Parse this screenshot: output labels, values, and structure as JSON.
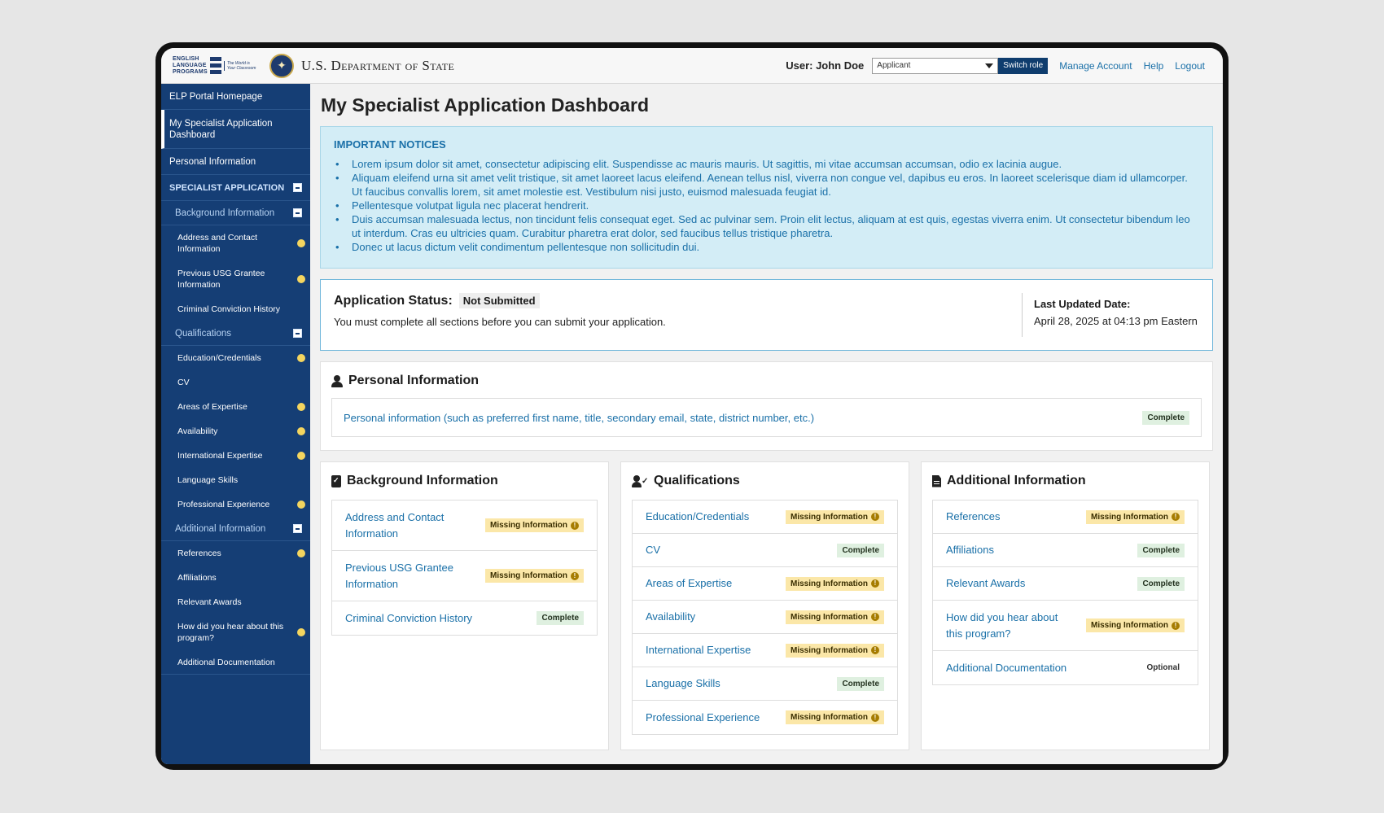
{
  "header": {
    "elp_logo_text": "ENGLISH LANGUAGE PROGRAMS",
    "elp_tagline": "The World is Your Classroom",
    "agency": "U.S. Department of State",
    "user_label": "User: John Doe",
    "role_value": "Applicant",
    "switch_role": "Switch role",
    "links": [
      "Manage Account",
      "Help",
      "Logout"
    ]
  },
  "sidebar": {
    "top": [
      {
        "label": "ELP Portal Homepage"
      },
      {
        "label": "My Specialist Application Dashboard"
      },
      {
        "label": "Personal Information"
      }
    ],
    "section": "SPECIALIST APPLICATION",
    "groups": [
      {
        "label": "Background Information",
        "items": [
          {
            "label": "Address and Contact Information",
            "flag": true
          },
          {
            "label": "Previous USG Grantee Information",
            "flag": true
          },
          {
            "label": "Criminal Conviction History",
            "flag": false
          }
        ]
      },
      {
        "label": "Qualifications",
        "items": [
          {
            "label": "Education/Credentials",
            "flag": true
          },
          {
            "label": "CV",
            "flag": false
          },
          {
            "label": "Areas of Expertise",
            "flag": true
          },
          {
            "label": "Availability",
            "flag": true
          },
          {
            "label": "International Expertise",
            "flag": true
          },
          {
            "label": "Language Skills",
            "flag": false
          },
          {
            "label": "Professional Experience",
            "flag": true
          }
        ]
      },
      {
        "label": "Additional Information",
        "items": [
          {
            "label": "References",
            "flag": true
          },
          {
            "label": "Affiliations",
            "flag": false
          },
          {
            "label": "Relevant Awards",
            "flag": false
          },
          {
            "label": "How did you hear about this program?",
            "flag": true
          },
          {
            "label": "Additional Documentation",
            "flag": false
          }
        ]
      }
    ]
  },
  "main": {
    "title": "My Specialist Application Dashboard",
    "notices": {
      "title": "IMPORTANT NOTICES",
      "items": [
        "Lorem ipsum dolor sit amet, consectetur adipiscing elit. Suspendisse ac mauris mauris. Ut sagittis, mi vitae accumsan accumsan, odio ex lacinia augue.",
        "Aliquam eleifend urna sit amet velit tristique, sit amet laoreet lacus eleifend. Aenean tellus nisl, viverra non congue vel, dapibus eu eros. In laoreet scelerisque diam id ullamcorper. Ut faucibus convallis lorem, sit amet molestie est. Vestibulum nisi justo, euismod malesuada feugiat id.",
        "Pellentesque volutpat ligula nec placerat hendrerit.",
        "Duis accumsan malesuada lectus, non tincidunt felis consequat eget. Sed ac pulvinar sem. Proin elit lectus, aliquam at est quis, egestas viverra enim. Ut consectetur bibendum leo ut interdum. Cras eu ultricies quam. Curabitur pharetra erat dolor, sed faucibus tellus tristique pharetra.",
        "Donec ut lacus dictum velit condimentum pellentesque non sollicitudin dui."
      ]
    },
    "status": {
      "label": "Application Status:",
      "value": "Not Submitted",
      "message": "You must complete all sections before you can submit your application.",
      "last_updated_label": "Last Updated Date:",
      "last_updated_value": "April 28, 2025 at 04:13 pm Eastern"
    },
    "personal": {
      "title": "Personal Information",
      "link": "Personal information (such as preferred first name, title, secondary email, state, district number, etc.)",
      "status": "Complete"
    },
    "cards": [
      {
        "title": "Background Information",
        "items": [
          {
            "label": "Address and Contact Information",
            "status": "Missing Information"
          },
          {
            "label": "Previous USG Grantee Information",
            "status": "Missing Information"
          },
          {
            "label": "Criminal Conviction History",
            "status": "Complete"
          }
        ]
      },
      {
        "title": "Qualifications",
        "items": [
          {
            "label": "Education/Credentials",
            "status": "Missing Information"
          },
          {
            "label": "CV",
            "status": "Complete"
          },
          {
            "label": "Areas of Expertise",
            "status": "Missing Information"
          },
          {
            "label": "Availability",
            "status": "Missing Information"
          },
          {
            "label": "International Expertise",
            "status": "Missing Information"
          },
          {
            "label": "Language Skills",
            "status": "Complete"
          },
          {
            "label": "Professional Experience",
            "status": "Missing Information"
          }
        ]
      },
      {
        "title": "Additional Information",
        "items": [
          {
            "label": "References",
            "status": "Missing Information"
          },
          {
            "label": "Affiliations",
            "status": "Complete"
          },
          {
            "label": "Relevant Awards",
            "status": "Complete"
          },
          {
            "label": "How did you hear about this program?",
            "status": "Missing Information"
          },
          {
            "label": "Additional Documentation",
            "status": "Optional"
          }
        ]
      }
    ]
  },
  "colors": {
    "sidebar": "#153e75",
    "link": "#1a70a8",
    "notice_bg": "#d3edf6",
    "missing": "#fbe7a8",
    "complete": "#dff0e0"
  }
}
